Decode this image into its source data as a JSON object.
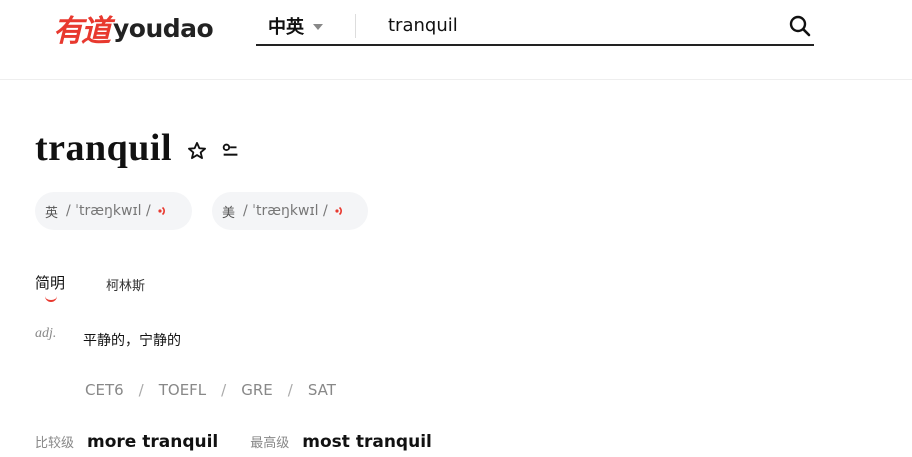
{
  "header": {
    "logo_cn": "有道",
    "logo_en": "youdao",
    "language": "中英",
    "search_value": "tranquil"
  },
  "entry": {
    "word": "tranquil",
    "phonetics": [
      {
        "region": "英",
        "text": "/ ˈtræŋkwɪl /"
      },
      {
        "region": "美",
        "text": "/ ˈtræŋkwɪl /"
      }
    ],
    "tabs": [
      "简明",
      "柯林斯"
    ],
    "pos": "adj.",
    "definition": "平静的，宁静的",
    "exams": [
      "CET6",
      "TOEFL",
      "GRE",
      "SAT"
    ],
    "forms": [
      {
        "label": "比较级",
        "value": "more tranquil"
      },
      {
        "label": "最高级",
        "value": "most tranquil"
      }
    ]
  },
  "colors": {
    "accent": "#e8392f"
  }
}
